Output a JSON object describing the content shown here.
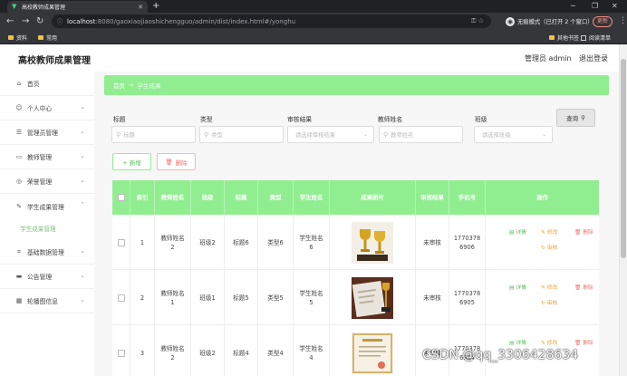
{
  "browser": {
    "tab_title": "高校教师成果管理",
    "url_host": "localhost",
    "url_rest": ":8080/gaoxiaojiaoshichengguo/admin/dist/index.html#/yonghu",
    "incognito_label": "无痕模式（已打开 2 个窗口）",
    "update_label": "更新",
    "bookmarks": [
      "资料",
      "常用"
    ],
    "bookmarks_right": [
      "其他书签",
      "阅读清单"
    ]
  },
  "app": {
    "title": "高校教师成果管理",
    "admin_label": "管理员 admin",
    "logout_label": "退出登录"
  },
  "sidebar": {
    "items": [
      {
        "label": "首页",
        "icon": "home-icon"
      },
      {
        "label": "个人中心",
        "icon": "user-icon"
      },
      {
        "label": "管理员管理",
        "icon": "sliders-icon"
      },
      {
        "label": "教师管理",
        "icon": "chat-icon"
      },
      {
        "label": "荣誉管理",
        "icon": "compass-icon"
      },
      {
        "label": "学生成果管理",
        "icon": "edit-icon"
      },
      {
        "label": "基础数据管理",
        "icon": "crop-icon"
      },
      {
        "label": "公告管理",
        "icon": "keyboard-icon"
      },
      {
        "label": "轮播图信息",
        "icon": "grid-icon"
      }
    ],
    "active_sub": "学生成果管理"
  },
  "breadcrumb": {
    "home": "首页",
    "current": "学生成果"
  },
  "filters": {
    "title_label": "标题",
    "title_placeholder": "标题",
    "type_label": "类型",
    "type_placeholder": "类型",
    "review_label": "审核结果",
    "review_placeholder": "请选择审核结果",
    "teacher_label": "教师姓名",
    "teacher_placeholder": "教师姓名",
    "class_label": "班级",
    "class_placeholder": "请选择班级",
    "query_button": "查询"
  },
  "actions": {
    "add": "+ 新增",
    "delete": "删除"
  },
  "table": {
    "headers": [
      "索引",
      "教师姓名",
      "班级",
      "标题",
      "类型",
      "学生姓名",
      "成果图片",
      "审核结果",
      "手机号",
      "操作"
    ],
    "action_labels": {
      "view": "详情",
      "edit": "修改",
      "delete": "删除",
      "review": "审核"
    },
    "rows": [
      {
        "index": "1",
        "teacher": "教师姓名\n2",
        "class": "班级2",
        "title": "标题6",
        "type": "类型6",
        "student": "学生姓名\n6",
        "image": "trophy",
        "review": "未审核",
        "phone": "1770378\n6906"
      },
      {
        "index": "2",
        "teacher": "教师姓名\n1",
        "class": "班级1",
        "title": "标题5",
        "type": "类型5",
        "student": "学生姓名\n5",
        "image": "certificate-trophy",
        "review": "未审核",
        "phone": "1770378\n6905"
      },
      {
        "index": "3",
        "teacher": "教师姓名\n2",
        "class": "班级2",
        "title": "标题4",
        "type": "类型4",
        "student": "学生姓名\n4",
        "image": "certificate",
        "review": "未审核",
        "phone": "1770378\n6904"
      }
    ]
  },
  "watermark": "CSDN @qq_3306428634",
  "colors": {
    "accent": "#90ee90",
    "danger": "#f07171",
    "warning": "#f0a030"
  }
}
